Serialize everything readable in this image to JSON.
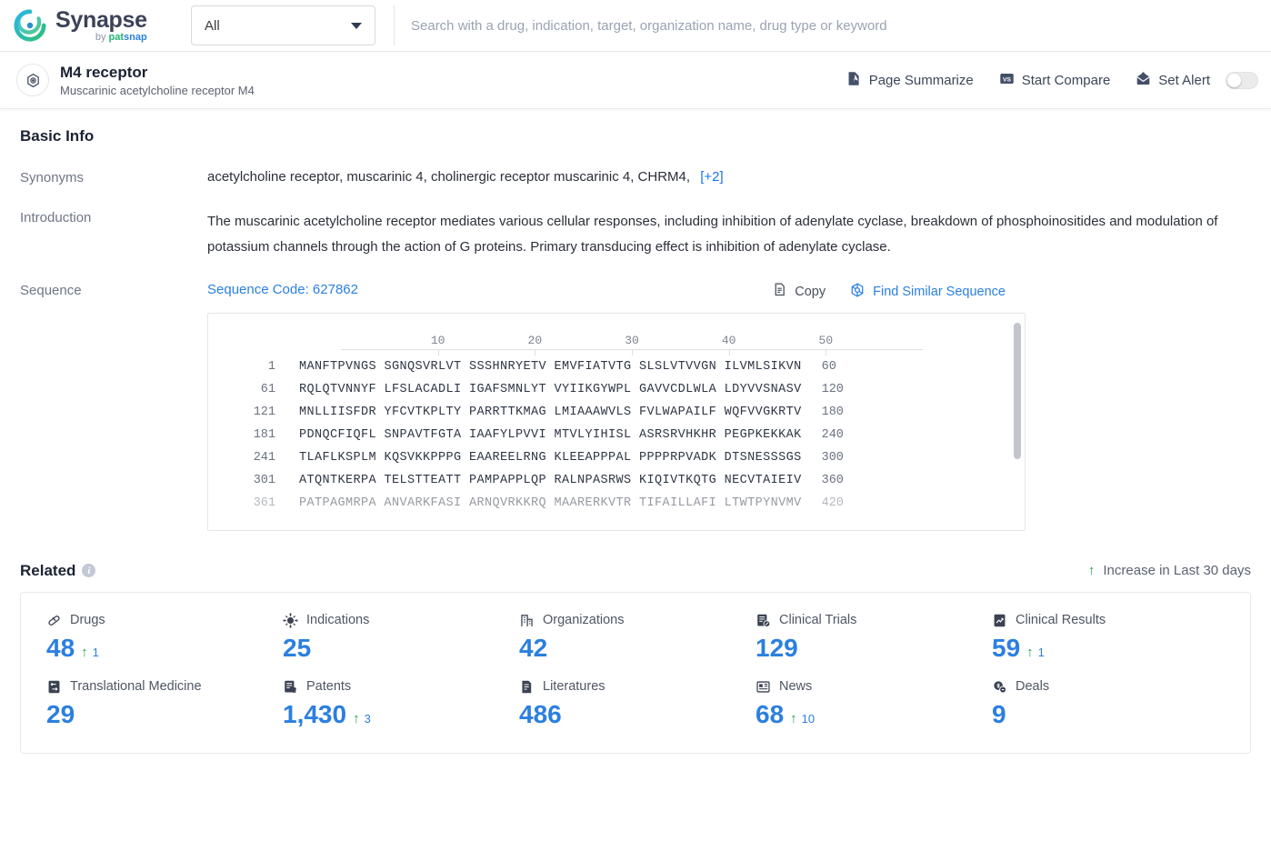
{
  "topbar": {
    "logo": {
      "title": "Synapse",
      "by": "by ",
      "pat": "pat",
      "snap": "snap"
    },
    "category_select": {
      "value": "All"
    },
    "search": {
      "placeholder": "Search with a drug, indication, target, organization name, drug type or keyword",
      "value": ""
    }
  },
  "entity": {
    "title": "M4 receptor",
    "subtitle": "Muscarinic acetylcholine receptor M4",
    "actions": [
      {
        "label": "Page Summarize",
        "icon": "page-summarize-icon"
      },
      {
        "label": "Start Compare",
        "icon": "versus-icon"
      },
      {
        "label": "Set Alert",
        "icon": "alert-mail-icon"
      }
    ],
    "alert_toggle_on": false
  },
  "basic_info": {
    "heading": "Basic Info",
    "synonyms": {
      "label": "Synonyms",
      "value": "acetylcholine receptor, muscarinic 4,  cholinergic receptor muscarinic 4,  CHRM4,",
      "more": "[+2]"
    },
    "introduction": {
      "label": "Introduction",
      "value": "The muscarinic acetylcholine receptor mediates various cellular responses, including inhibition of adenylate cyclase, breakdown of phosphoinositides and modulation of potassium channels through the action of G proteins. Primary transducing effect is inhibition of adenylate cyclase."
    },
    "sequence": {
      "label": "Sequence",
      "code_text": "Sequence Code: 627862",
      "copy_label": "Copy",
      "find_similar_label": "Find Similar Sequence",
      "ruler_ticks": [
        10,
        20,
        30,
        40,
        50
      ],
      "rows": [
        {
          "start": "1",
          "letters": "MANFTPVNGS SGNQSVRLVT SSSHNRYETV EMVFIATVTG SLSLVTVVGN ILVMLSIKVN",
          "end": "60"
        },
        {
          "start": "61",
          "letters": "RQLQTVNNYF LFSLACADLI IGAFSMNLYT VYIIKGYWPL GAVVCDLWLA LDYVVSNASV",
          "end": "120"
        },
        {
          "start": "121",
          "letters": "MNLLIISFDR YFCVTKPLTY PARRTTKMAG LMIAAAWVLS FVLWAPAILF WQFVVGKRTV",
          "end": "180"
        },
        {
          "start": "181",
          "letters": "PDNQCFIQFL SNPAVTFGTA IAAFYLPVVI MTVLYIHISL ASRSRVHKHR PEGPKEKKAK",
          "end": "240"
        },
        {
          "start": "241",
          "letters": "TLAFLKSPLM KQSVKKPPPG EAAREELRNG KLEEAPPPAL PPPPRPVADK DTSNESSSGS",
          "end": "300"
        },
        {
          "start": "301",
          "letters": "ATQNTKERPA TELSTTEATT PAMPAPPLQP RALNPASRWS KIQIVTKQTG NECVTAIEIV",
          "end": "360"
        },
        {
          "start": "361",
          "letters": "PATPAGMRPA ANVARKFASI ARNQVRKKRQ MAARERKVTR TIFAILLAFI LTWTPYNVMV",
          "end": "420"
        }
      ]
    }
  },
  "related": {
    "heading": "Related",
    "legend": "Increase in Last 30 days",
    "legend_arrow": "↑",
    "stats": [
      {
        "label": "Drugs",
        "icon": "capsule-icon",
        "value": "48",
        "delta": "1"
      },
      {
        "label": "Indications",
        "icon": "virus-icon",
        "value": "25",
        "delta": ""
      },
      {
        "label": "Organizations",
        "icon": "building-icon",
        "value": "42",
        "delta": ""
      },
      {
        "label": "Clinical Trials",
        "icon": "clinical-trial-icon",
        "value": "129",
        "delta": ""
      },
      {
        "label": "Clinical Results",
        "icon": "clinical-result-icon",
        "value": "59",
        "delta": "1"
      },
      {
        "label": "Translational Medicine",
        "icon": "translational-icon",
        "value": "29",
        "delta": ""
      },
      {
        "label": "Patents",
        "icon": "patent-icon",
        "value": "1,430",
        "delta": "3"
      },
      {
        "label": "Literatures",
        "icon": "literature-icon",
        "value": "486",
        "delta": ""
      },
      {
        "label": "News",
        "icon": "news-icon",
        "value": "68",
        "delta": "10"
      },
      {
        "label": "Deals",
        "icon": "deals-icon",
        "value": "9",
        "delta": ""
      }
    ]
  },
  "colors": {
    "accent_blue": "#2b7fe0",
    "increase_green": "#22a447",
    "link_blue": "#1a73e8"
  }
}
